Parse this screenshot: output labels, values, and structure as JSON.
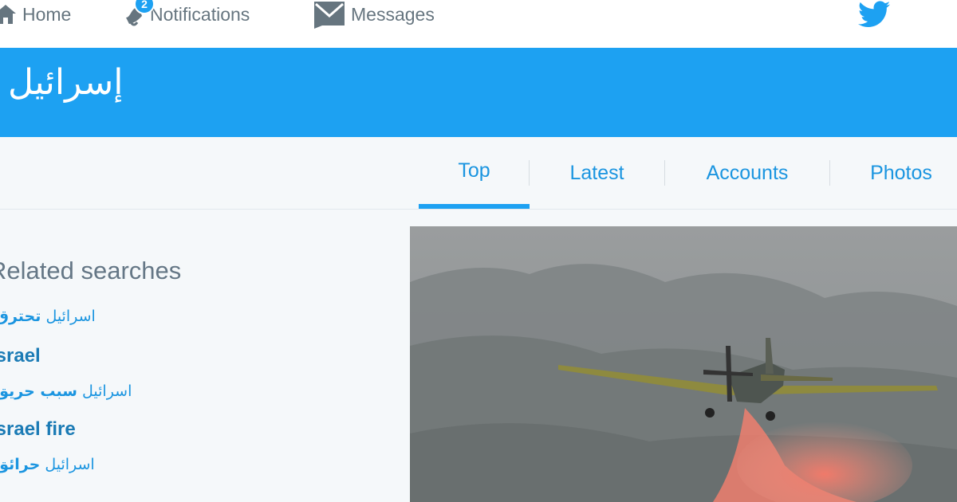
{
  "topnav": {
    "home_label": "Home",
    "notifications_label": "Notifications",
    "notifications_count": "2",
    "messages_label": "Messages"
  },
  "header": {
    "title": "إسرائيل"
  },
  "tabs": [
    {
      "label": "Top",
      "active": true
    },
    {
      "label": "Latest",
      "active": false
    },
    {
      "label": "Accounts",
      "active": false
    },
    {
      "label": "Photos",
      "active": false
    }
  ],
  "related": {
    "title": "Related searches",
    "items": [
      {
        "normal": "اسرائيل",
        "bold": "تحترق"
      },
      {
        "bold": "israel"
      },
      {
        "normal": "اسرائيل",
        "bold": "سبب حريق"
      },
      {
        "bold": "israel fire"
      },
      {
        "normal": "اسرائيل",
        "bold": "حرائق"
      }
    ]
  },
  "colors": {
    "brand": "#1da1f2",
    "link": "#1b95e0",
    "nav_text": "#66757f"
  },
  "icons": [
    "home-icon",
    "notifications-icon",
    "messages-icon",
    "twitter-bird-icon"
  ]
}
